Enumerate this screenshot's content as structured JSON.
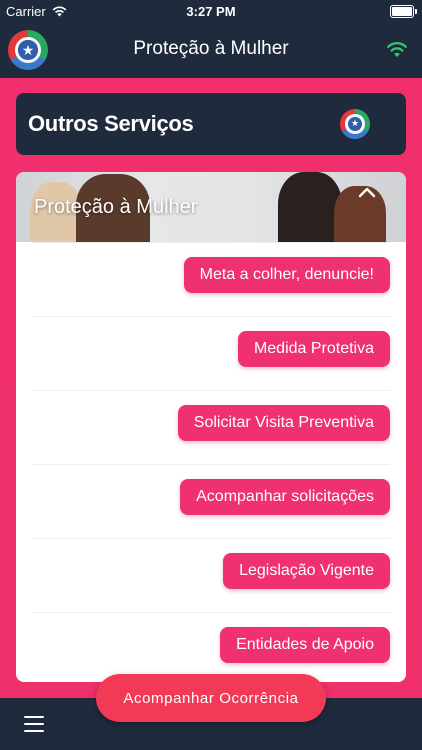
{
  "status_bar": {
    "carrier": "Carrier",
    "time": "3:27 PM"
  },
  "header": {
    "title": "Proteção à Mulher"
  },
  "services": {
    "heading": "Outros Serviços",
    "banner_title": "Proteção à Mulher",
    "items": [
      {
        "label": "Meta a colher, denuncie!"
      },
      {
        "label": "Medida Protetiva"
      },
      {
        "label": "Solicitar Visita Preventiva"
      },
      {
        "label": "Acompanhar solicitações"
      },
      {
        "label": "Legislação Vigente"
      },
      {
        "label": "Entidades de Apoio"
      }
    ]
  },
  "footer": {
    "action_label": "Acompanhar Ocorrência"
  },
  "colors": {
    "navy": "#1f2b3d",
    "pink": "#f0316f",
    "fab": "#f23a57",
    "wifi": "#2ecc71"
  }
}
